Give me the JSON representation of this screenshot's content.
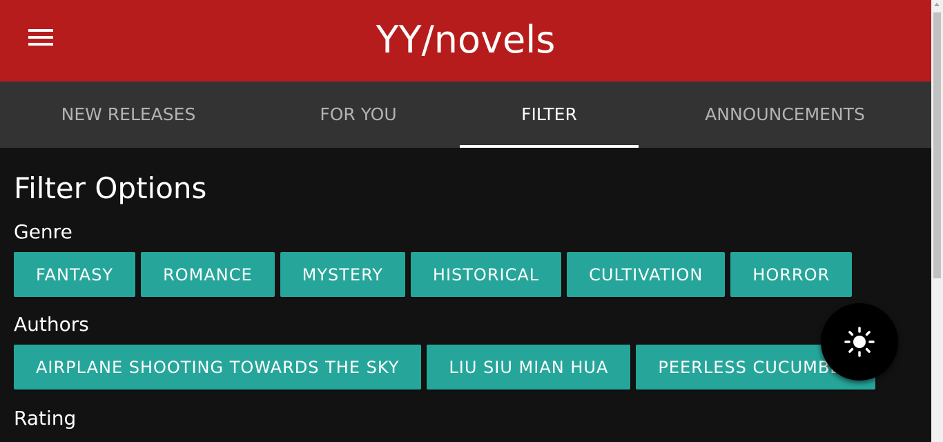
{
  "header": {
    "title": "YY/novels",
    "menu_icon": "hamburger-menu-icon"
  },
  "tabs": [
    {
      "label": "NEW RELEASES",
      "active": false
    },
    {
      "label": "FOR YOU",
      "active": false
    },
    {
      "label": "FILTER",
      "active": true
    },
    {
      "label": "ANNOUNCEMENTS",
      "active": false
    }
  ],
  "filter": {
    "heading": "Filter Options",
    "genre": {
      "label": "Genre",
      "options": [
        "FANTASY",
        "ROMANCE",
        "MYSTERY",
        "HISTORICAL",
        "CULTIVATION",
        "HORROR"
      ]
    },
    "authors": {
      "label": "Authors",
      "options": [
        "AIRPLANE SHOOTING TOWARDS THE SKY",
        "LIU SIU MIAN HUA",
        "PEERLESS CUCUMBER"
      ]
    },
    "rating": {
      "label": "Rating"
    }
  },
  "fab": {
    "icon": "brightness-sun-icon"
  },
  "colors": {
    "header": "#b71c1c",
    "tabbar": "#333333",
    "background": "#121212",
    "chip": "#26a69a",
    "fab": "#000000"
  }
}
